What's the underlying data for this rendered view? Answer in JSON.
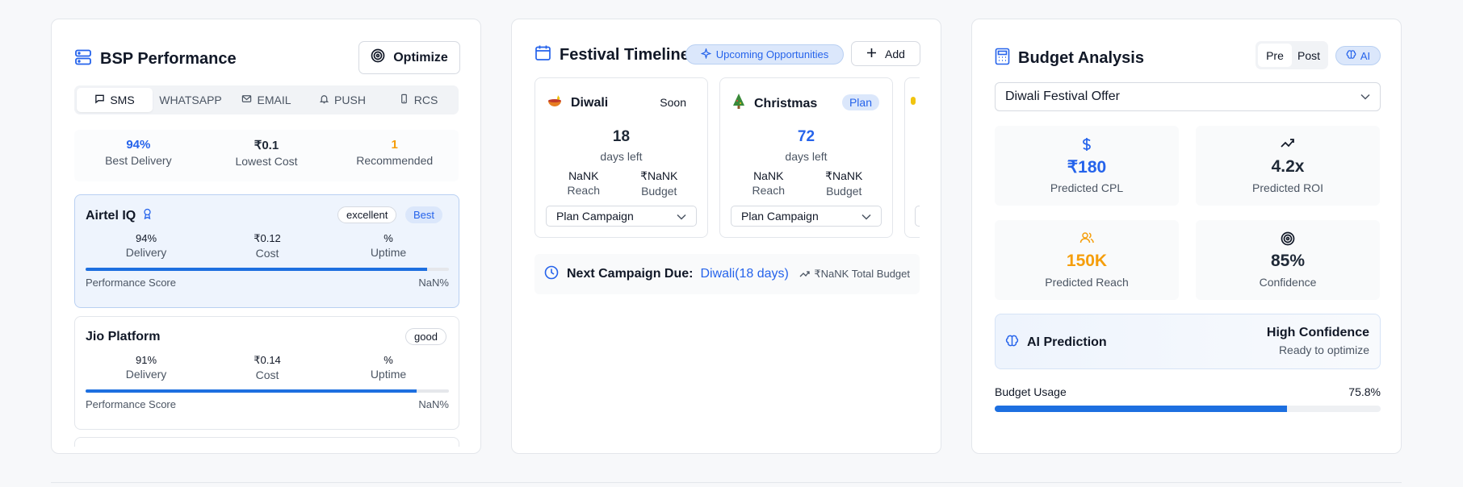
{
  "bsp": {
    "title": "BSP Performance",
    "optimize_label": "Optimize",
    "tabs": [
      {
        "label": "SMS",
        "icon": "message-icon"
      },
      {
        "label": "WHATSAPP",
        "icon": ""
      },
      {
        "label": "EMAIL",
        "icon": "mail-icon"
      },
      {
        "label": "PUSH",
        "icon": "bell-icon"
      },
      {
        "label": "RCS",
        "icon": "phone-icon"
      }
    ],
    "summary": [
      {
        "value": "94%",
        "label": "Best Delivery",
        "color": "#2563eb"
      },
      {
        "value": "₹0.1",
        "label": "Lowest Cost",
        "color": "#111827"
      },
      {
        "value": "1",
        "label": "Recommended",
        "color": "#f59e0b"
      }
    ],
    "providers": [
      {
        "name": "Airtel IQ",
        "rating": "excellent",
        "badge": "Best",
        "delivery": "94%",
        "delivery_label": "Delivery",
        "cost": "₹0.12",
        "cost_label": "Cost",
        "uptime": "%",
        "uptime_label": "Uptime",
        "score_label": "Performance Score",
        "score_value": "NaN%",
        "bar_fraction": 0.94
      },
      {
        "name": "Jio Platform",
        "rating": "good",
        "delivery": "91%",
        "delivery_label": "Delivery",
        "cost": "₹0.14",
        "cost_label": "Cost",
        "uptime": "%",
        "uptime_label": "Uptime",
        "score_label": "Performance Score",
        "score_value": "NaN%",
        "bar_fraction": 0.91
      }
    ]
  },
  "festival": {
    "title": "Festival Timeline",
    "upcoming_label": "Upcoming Opportunities",
    "add_label": "Add",
    "items": [
      {
        "name": "Diwali",
        "status": "Soon",
        "days": "18",
        "days_label": "days left",
        "reach": "NaNK",
        "reach_label": "Reach",
        "budget": "₹NaNK",
        "budget_label": "Budget",
        "action": "Plan Campaign"
      },
      {
        "name": "Christmas",
        "status": "Plan",
        "days": "72",
        "days_label": "days left",
        "reach": "NaNK",
        "reach_label": "Reach",
        "budget": "₹NaNK",
        "budget_label": "Budget",
        "action": "Plan Campaign"
      }
    ],
    "next_label": "Next Campaign Due:",
    "next_value": "Diwali(18 days)",
    "total_budget": "₹NaNK Total Budget"
  },
  "budget": {
    "title": "Budget Analysis",
    "toggle": [
      "Pre",
      "Post"
    ],
    "ai_label": "AI",
    "selected_campaign": "Diwali Festival Offer",
    "tiles": [
      {
        "value": "₹180",
        "label": "Predicted CPL",
        "icon": "dollar-icon",
        "color": "#2563eb"
      },
      {
        "value": "4.2x",
        "label": "Predicted ROI",
        "icon": "trending-up-icon",
        "color": "#111827"
      },
      {
        "value": "150K",
        "label": "Predicted Reach",
        "icon": "users-icon",
        "color": "#f59e0b"
      },
      {
        "value": "85%",
        "label": "Confidence",
        "icon": "target-icon",
        "color": "#111827"
      }
    ],
    "ai_prediction_label": "AI Prediction",
    "confidence_label": "High Confidence",
    "ready_label": "Ready to optimize",
    "usage_label": "Budget Usage",
    "usage_value": "75.8%",
    "usage_fraction": 0.758
  },
  "colors": {
    "accent": "#2563eb",
    "warning": "#f59e0b",
    "bar": "#1d6fe0"
  }
}
